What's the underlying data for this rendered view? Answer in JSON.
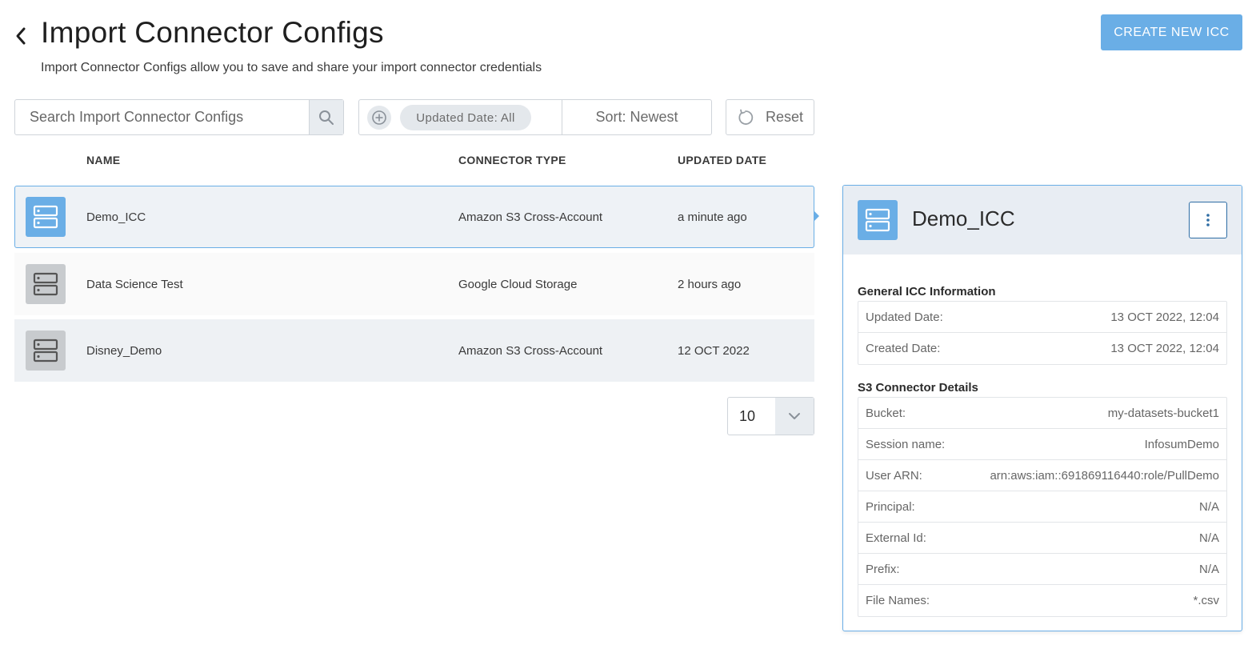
{
  "header": {
    "title": "Import Connector Configs",
    "subtitle": "Import Connector Configs allow you to save and share your import connector credentials",
    "create_button": "CREATE NEW ICC"
  },
  "toolbar": {
    "search_placeholder": "Search Import Connector Configs",
    "filter_chip": "Updated Date: All",
    "sort_label": "Sort: Newest",
    "reset_label": "Reset"
  },
  "table": {
    "columns": [
      "NAME",
      "CONNECTOR TYPE",
      "UPDATED DATE"
    ],
    "rows": [
      {
        "name": "Demo_ICC",
        "type": "Amazon S3 Cross-Account",
        "updated": "a minute ago",
        "selected": true
      },
      {
        "name": "Data Science Test",
        "type": "Google Cloud Storage",
        "updated": "2 hours ago",
        "selected": false
      },
      {
        "name": "Disney_Demo",
        "type": "Amazon S3 Cross-Account",
        "updated": "12 OCT 2022",
        "selected": false
      }
    ]
  },
  "pagination": {
    "page_size": "10"
  },
  "detail": {
    "title": "Demo_ICC",
    "general_title": "General ICC Information",
    "general": [
      {
        "label": "Updated Date:",
        "value": "13 OCT 2022, 12:04"
      },
      {
        "label": "Created Date:",
        "value": "13 OCT 2022, 12:04"
      }
    ],
    "connector_title": "S3 Connector Details",
    "connector": [
      {
        "label": "Bucket:",
        "value": "my-datasets-bucket1"
      },
      {
        "label": "Session name:",
        "value": "InfosumDemo"
      },
      {
        "label": "User ARN:",
        "value": "arn:aws:iam::691869116440:role/PullDemo"
      },
      {
        "label": "Principal:",
        "value": "N/A"
      },
      {
        "label": "External Id:",
        "value": "N/A"
      },
      {
        "label": "Prefix:",
        "value": "N/A"
      },
      {
        "label": "File Names:",
        "value": "*.csv"
      }
    ]
  },
  "colors": {
    "accent": "#6aaee6",
    "selected_row_bg": "#eef2f6",
    "grey_icon": "#c8cbce"
  },
  "icons": {
    "back": "chevron-left-icon",
    "search": "search-icon",
    "add_filter": "plus-circle-icon",
    "reset": "refresh-icon",
    "row_icon": "server-icon",
    "more": "kebab-icon",
    "pager": "chevron-down-icon"
  }
}
